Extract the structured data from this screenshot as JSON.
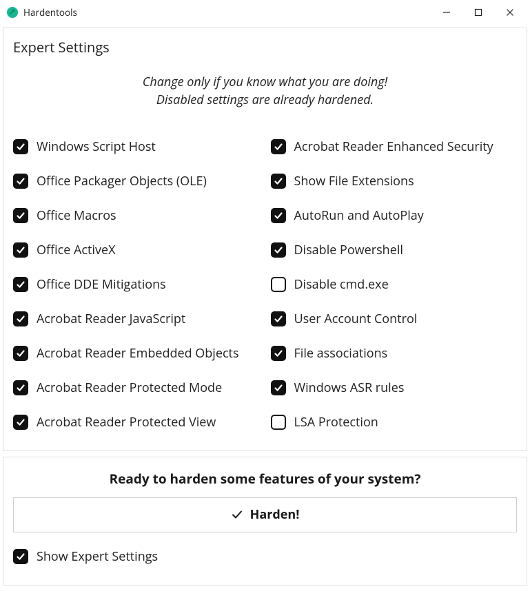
{
  "window": {
    "title": "Hardentools"
  },
  "header": {
    "title": "Expert Settings",
    "warning_line1": "Change only if you know what you are doing!",
    "warning_line2": "Disabled settings are already hardened."
  },
  "settings": {
    "left": [
      {
        "label": "Windows Script Host",
        "checked": true
      },
      {
        "label": "Office Packager Objects (OLE)",
        "checked": true
      },
      {
        "label": "Office Macros",
        "checked": true
      },
      {
        "label": "Office ActiveX",
        "checked": true
      },
      {
        "label": "Office DDE Mitigations",
        "checked": true
      },
      {
        "label": "Acrobat Reader JavaScript",
        "checked": true
      },
      {
        "label": "Acrobat Reader Embedded Objects",
        "checked": true
      },
      {
        "label": "Acrobat Reader Protected Mode",
        "checked": true
      },
      {
        "label": "Acrobat Reader Protected View",
        "checked": true
      }
    ],
    "right": [
      {
        "label": "Acrobat Reader Enhanced Security",
        "checked": true
      },
      {
        "label": "Show File Extensions",
        "checked": true
      },
      {
        "label": "AutoRun and AutoPlay",
        "checked": true
      },
      {
        "label": "Disable Powershell",
        "checked": true
      },
      {
        "label": "Disable cmd.exe",
        "checked": false
      },
      {
        "label": "User Account Control",
        "checked": true
      },
      {
        "label": "File associations",
        "checked": true
      },
      {
        "label": "Windows ASR rules",
        "checked": true
      },
      {
        "label": "LSA Protection",
        "checked": false
      }
    ]
  },
  "action": {
    "heading": "Ready to harden some features of your system?",
    "button_label": "Harden!",
    "show_expert_label": "Show Expert Settings",
    "show_expert_checked": true
  }
}
